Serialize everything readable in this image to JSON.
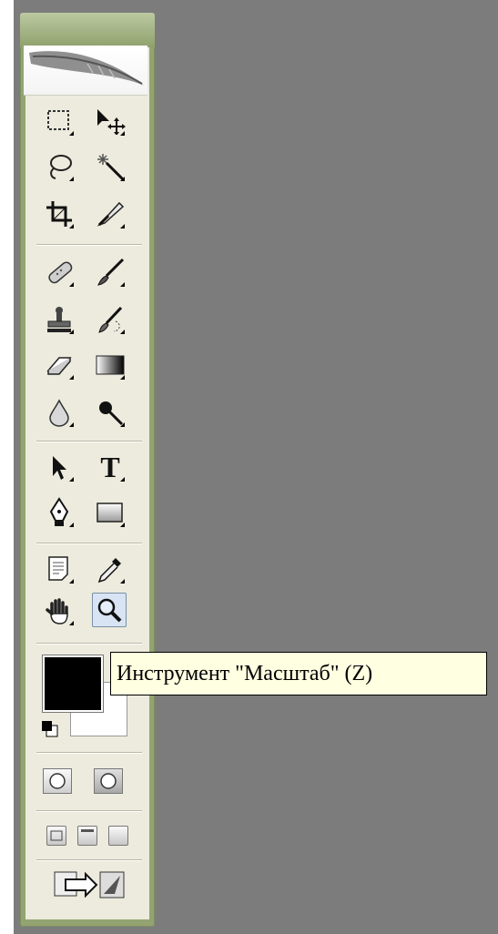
{
  "toolbox": {
    "tools": [
      {
        "id": "rect-marquee",
        "icon": "rectangular-marquee-icon"
      },
      {
        "id": "move",
        "icon": "move-icon"
      },
      {
        "id": "lasso",
        "icon": "lasso-icon"
      },
      {
        "id": "magic-wand",
        "icon": "magic-wand-icon"
      },
      {
        "id": "crop",
        "icon": "crop-icon"
      },
      {
        "id": "slice",
        "icon": "slice-icon"
      },
      {
        "id": "healing-brush",
        "icon": "healing-brush-icon"
      },
      {
        "id": "brush",
        "icon": "brush-icon"
      },
      {
        "id": "clone-stamp",
        "icon": "clone-stamp-icon"
      },
      {
        "id": "history-brush",
        "icon": "history-brush-icon"
      },
      {
        "id": "eraser",
        "icon": "eraser-icon"
      },
      {
        "id": "gradient",
        "icon": "gradient-icon"
      },
      {
        "id": "blur",
        "icon": "blur-drop-icon"
      },
      {
        "id": "dodge",
        "icon": "dodge-icon"
      },
      {
        "id": "path-selection",
        "icon": "path-selection-icon"
      },
      {
        "id": "type",
        "icon": "type-icon",
        "glyph": "T"
      },
      {
        "id": "pen",
        "icon": "pen-icon"
      },
      {
        "id": "rectangle-shape",
        "icon": "rectangle-shape-icon"
      },
      {
        "id": "notes",
        "icon": "notes-icon"
      },
      {
        "id": "eyedropper",
        "icon": "eyedropper-icon"
      },
      {
        "id": "hand",
        "icon": "hand-icon"
      },
      {
        "id": "zoom",
        "icon": "zoom-icon",
        "active": true
      }
    ],
    "colors": {
      "foreground": "#000000",
      "background": "#ffffff"
    }
  },
  "tooltip": {
    "text": "Инструмент \"Масштаб\" (Z)"
  },
  "theme": {
    "workspace": "#7c7c7c",
    "toolbox_frame": "#93a472",
    "toolbox_body": "#ecebdd",
    "tooltip_bg": "#ffffe1"
  }
}
